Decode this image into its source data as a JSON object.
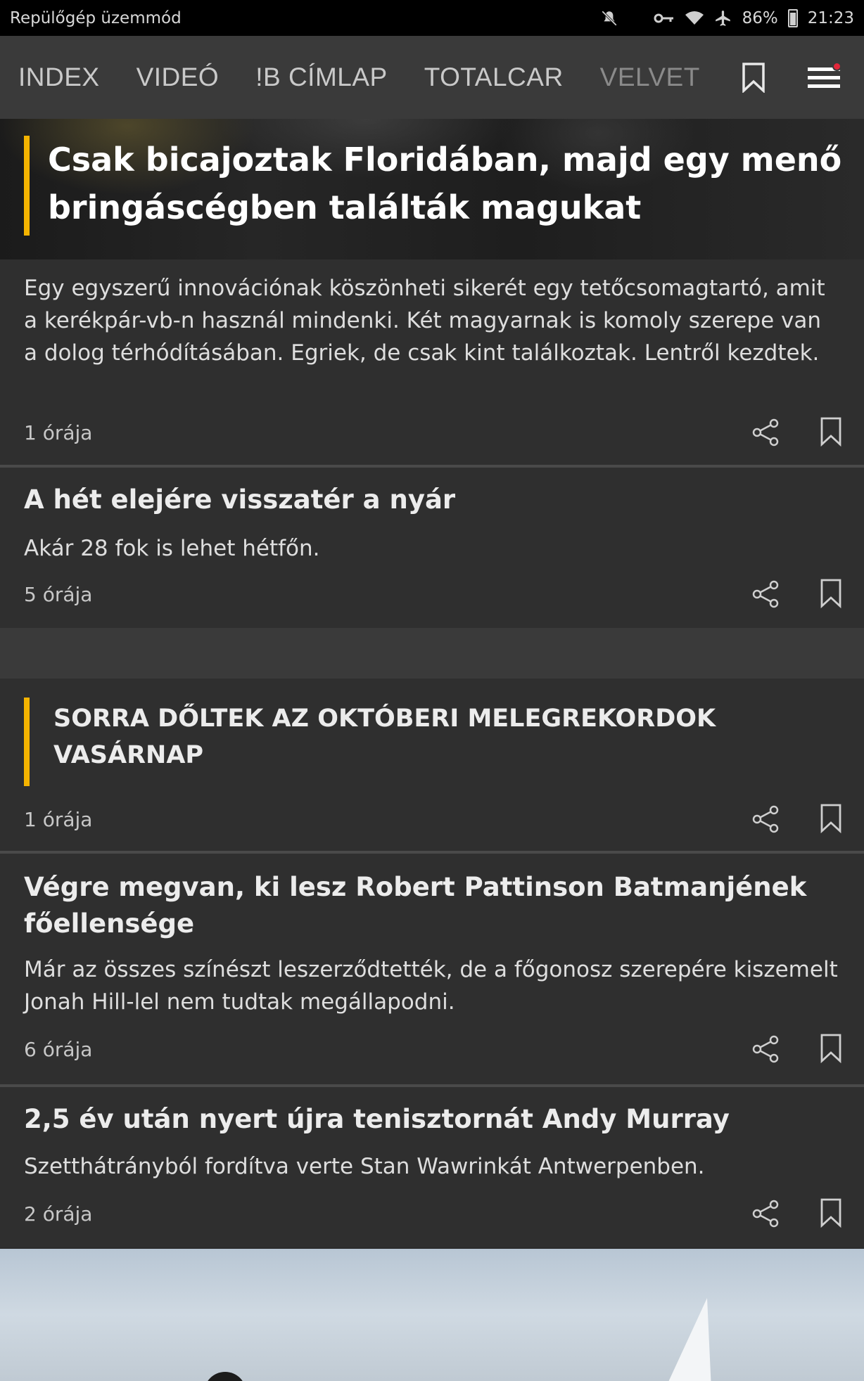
{
  "status_bar": {
    "mode_label": "Repülőgép üzemmód",
    "battery": "86%",
    "time": "21:23",
    "icons": [
      "mute-icon",
      "moon-icon",
      "key-icon",
      "wifi-icon",
      "airplane-icon",
      "battery-icon"
    ]
  },
  "nav": {
    "tabs": [
      "INDEX",
      "VIDEÓ",
      "!B CÍMLAP",
      "TOTALCAR",
      "VELVET"
    ],
    "icons": [
      "bookmark-icon",
      "menu-icon"
    ],
    "accent": "#e2263a"
  },
  "hero": {
    "title": "Csak bicajoztak Floridában, majd egy menő bringáscégben találták magukat",
    "lead": "Egy egyszerű innovációnak köszönheti sikerét egy tetőcsomagtartó, amit a kerékpár-vb-n használ mindenki. Két magyarnak is komoly szerepe van a dolog térhódításában. Egriek, de csak kint találkoztak. Lentről kezdtek.",
    "time": "1 órája",
    "accent": "#f5b400"
  },
  "articles": [
    {
      "title": "A hét elejére visszatér a nyár",
      "lead": "Akár 28 fok is lehet hétfőn.",
      "time": "5 órája"
    },
    {
      "title": "Végre megvan, ki lesz Robert Pattinson Batmanjének főellensége",
      "lead": "Már az összes színészt leszerződtették, de a főgonosz szerepére kiszemelt Jonah Hill-lel nem tudtak megállapodni.",
      "time": "6 órája"
    },
    {
      "title": "2,5 év után nyert újra tenisztornát Andy Murray",
      "lead": "Szetthátrányból fordítva verte Stan Wawrinkát Antwerpenben.",
      "time": "2 órája"
    }
  ],
  "section": {
    "title": "SORRA DŐLTEK AZ OKTÓBERI MELEGREKORDOK VASÁRNAP",
    "time": "1 órája"
  }
}
